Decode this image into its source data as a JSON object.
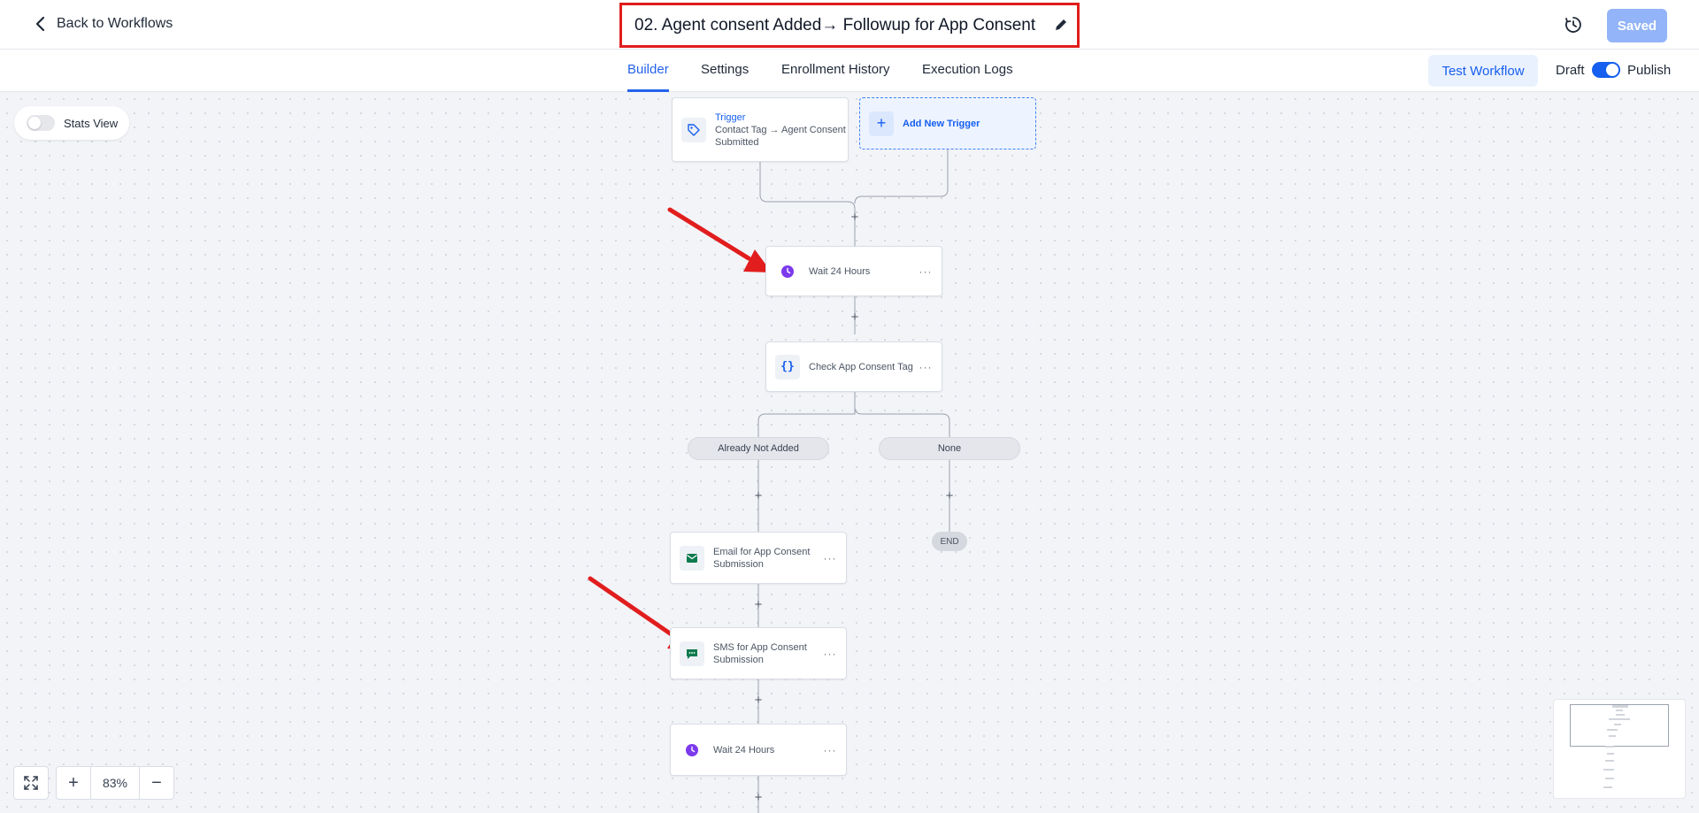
{
  "header": {
    "back_label": "Back to Workflows",
    "title": "02. Agent consent Added→ Followup for App Consent",
    "saved_label": "Saved"
  },
  "tabs": [
    {
      "label": "Builder",
      "active": true
    },
    {
      "label": "Settings",
      "active": false
    },
    {
      "label": "Enrollment History",
      "active": false
    },
    {
      "label": "Execution Logs",
      "active": false
    }
  ],
  "toolbar": {
    "test_label": "Test Workflow",
    "draft_label": "Draft",
    "publish_label": "Publish",
    "publish_toggle_on": true
  },
  "canvas": {
    "stats_label": "Stats View",
    "trigger": {
      "title": "Trigger",
      "text": "Contact Tag → Agent Consent Submitted"
    },
    "add_trigger_label": "Add New Trigger",
    "nodes": [
      {
        "label": "Wait 24 Hours",
        "icon": "clock-icon"
      },
      {
        "label": "Check App Consent Tag",
        "icon": "curly-braces-icon"
      },
      {
        "label": "Email for App Consent Submission",
        "icon": "email-icon"
      },
      {
        "label": "SMS for App Consent Submission",
        "icon": "sms-icon"
      },
      {
        "label": "Wait 24 Hours",
        "icon": "clock-icon"
      }
    ],
    "branches": [
      "Already Not Added",
      "None"
    ],
    "end_label": "END",
    "menu_dots": "···"
  },
  "zoom": {
    "value": "83%"
  },
  "colors": {
    "accent": "#155eef",
    "annotation": "#e11d1d"
  }
}
